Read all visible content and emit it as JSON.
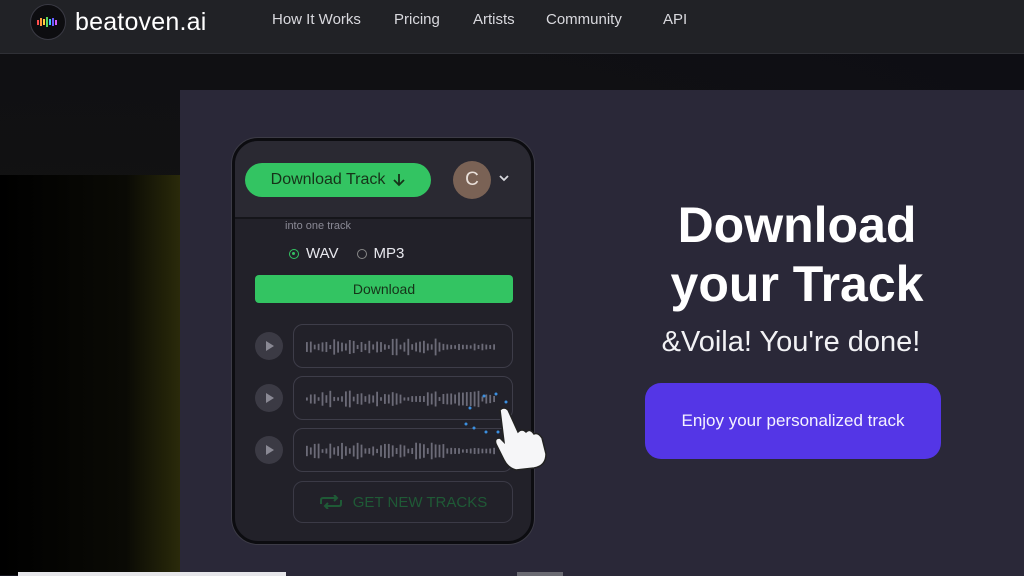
{
  "brand": {
    "name": "beatoven.ai",
    "accent": "#33c462",
    "cta_color": "#5436e6"
  },
  "nav": {
    "links": [
      "How It Works",
      "Pricing",
      "Artists",
      "Community",
      "API"
    ]
  },
  "phone": {
    "download_track_label": "Download Track",
    "avatar_letter": "C",
    "merge_caption": "into one track",
    "formats": [
      {
        "label": "WAV",
        "selected": true
      },
      {
        "label": "MP3",
        "selected": false
      }
    ],
    "download_label": "Download",
    "tracks_count_visible": 3,
    "get_new_label": "GET NEW TRACKS"
  },
  "hero": {
    "headline_line1": "Download",
    "headline_line2": "your Track",
    "subline": "&Voila! You're done!",
    "cta_label": "Enjoy your personalized track"
  }
}
